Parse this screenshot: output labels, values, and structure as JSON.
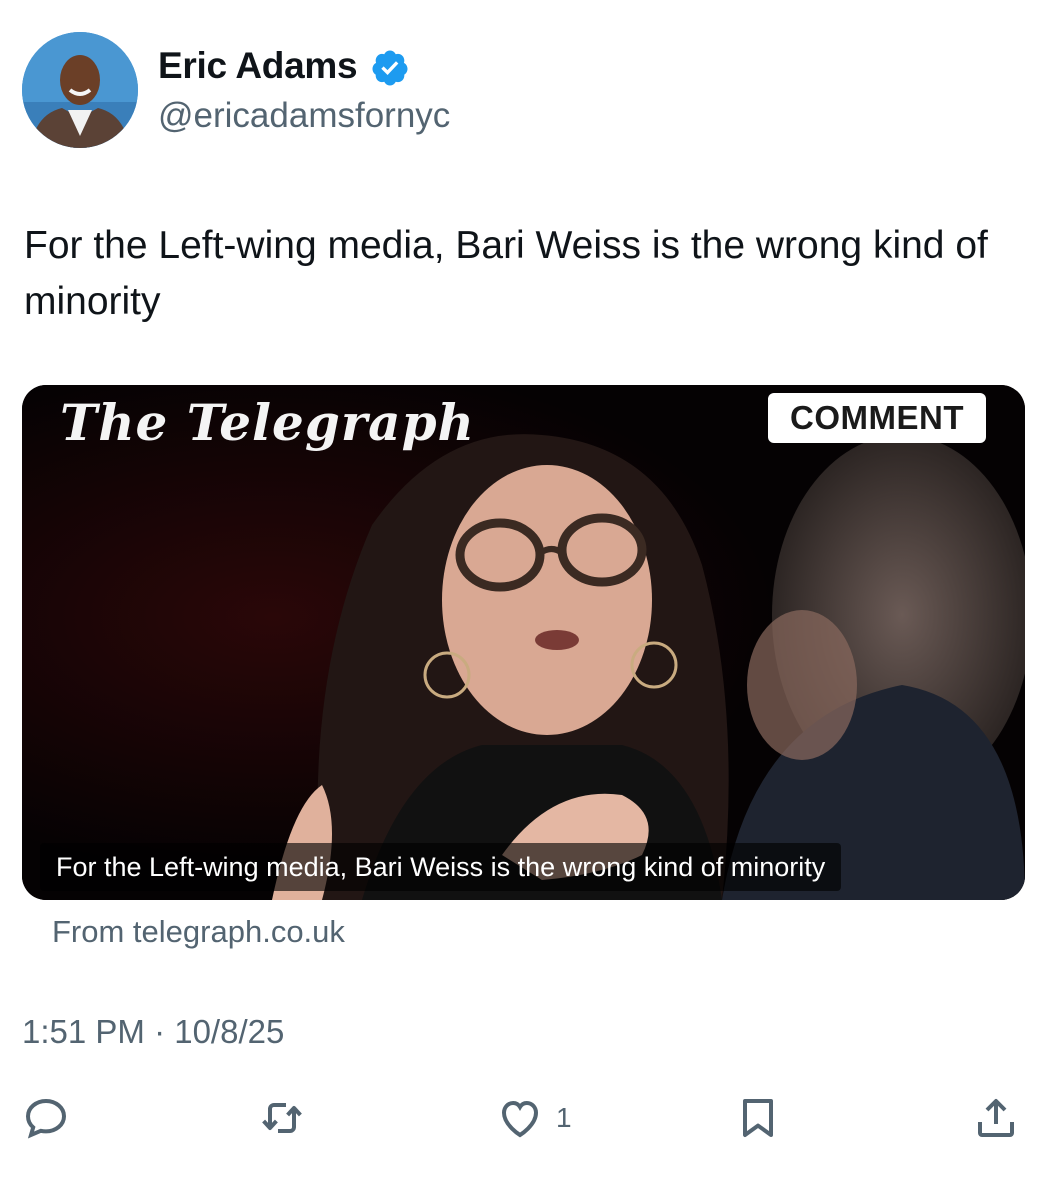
{
  "author": {
    "display_name": "Eric Adams",
    "handle": "@ericadamsfornyc",
    "verified": true,
    "verified_color": "#1d9bf0"
  },
  "tweet": {
    "text": "For the Left-wing media, Bari Weiss is the wrong kind of minority",
    "timestamp": "1:51 PM · 10/8/25"
  },
  "card": {
    "masthead": "The Telegraph",
    "badge": "COMMENT",
    "caption": "For the Left-wing media, Bari Weiss is the wrong kind of minority",
    "source": "From telegraph.co.uk"
  },
  "actions": {
    "reply_icon": "reply-icon",
    "retweet_icon": "retweet-icon",
    "like_icon": "heart-icon",
    "like_count": "1",
    "bookmark_icon": "bookmark-icon",
    "share_icon": "share-icon",
    "icon_color": "#536471"
  }
}
